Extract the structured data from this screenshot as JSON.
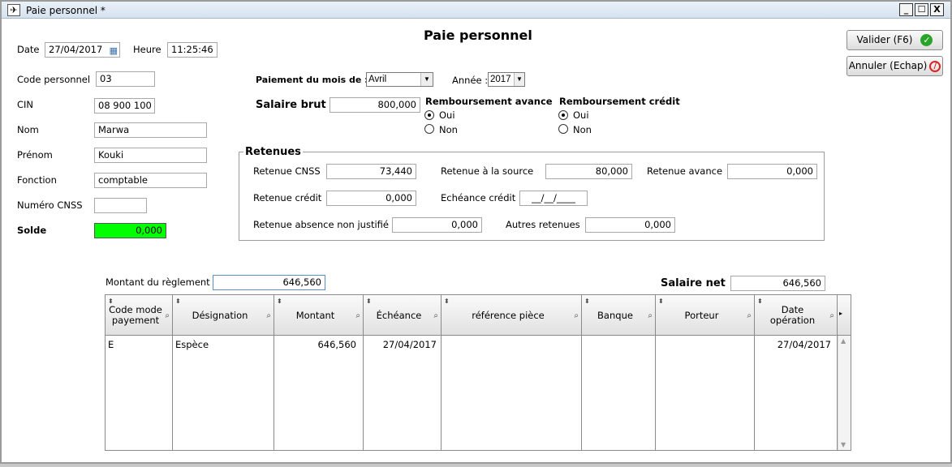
{
  "window": {
    "title": "Paie personnel *",
    "minimize": "_",
    "maximize": "☐",
    "close": "X"
  },
  "form_title": "Paie personnel",
  "header": {
    "date_label": "Date",
    "date_value": "27/04/2017",
    "heure_label": "Heure",
    "heure_value": "11:25:46"
  },
  "buttons": {
    "valider": "Valider (F6)",
    "annuler": "Annuler (Echap)"
  },
  "employee": {
    "code_label": "Code personnel",
    "code_value": "03",
    "cin_label": "CIN",
    "cin_value": "08 900 100",
    "nom_label": "Nom",
    "nom_value": "Marwa",
    "prenom_label": "Prénom",
    "prenom_value": "Kouki",
    "fonction_label": "Fonction",
    "fonction_value": "comptable",
    "cnss_label": "Numéro CNSS",
    "cnss_value": "",
    "solde_label": "Solde",
    "solde_value": "0,000"
  },
  "payment": {
    "mois_label": "Paiement du mois de :",
    "mois_value": "Avril",
    "annee_label": "Année :",
    "annee_value": "2017",
    "brut_label": "Salaire brut",
    "brut_value": "800,000",
    "avance_label": "Remboursement avance",
    "credit_label": "Remboursement crédit",
    "oui": "Oui",
    "non": "Non",
    "avance_selected": "Oui",
    "credit_selected": "Oui"
  },
  "retenues": {
    "title": "Retenues",
    "cnss_label": "Retenue CNSS",
    "cnss_value": "73,440",
    "source_label": "Retenue à la source",
    "source_value": "80,000",
    "avance_label": "Retenue avance",
    "avance_value": "0,000",
    "credit_label": "Retenue crédit",
    "credit_value": "0,000",
    "echeance_label": "Echéance crédit",
    "echeance_value": "__/__/____",
    "absence_label": "Retenue absence non justifié",
    "absence_value": "0,000",
    "autres_label": "Autres retenues",
    "autres_value": "0,000"
  },
  "reglement": {
    "montant_label": "Montant du règlement",
    "montant_value": "646,560",
    "net_label": "Salaire net",
    "net_value": "646,560"
  },
  "table": {
    "columns": [
      "Code mode payement",
      "Désignation",
      "Montant",
      "Échéance",
      "référence pièce",
      "Banque",
      "Porteur",
      "Date opération"
    ],
    "rows": [
      [
        "E",
        "Espèce",
        "646,560",
        "27/04/2017",
        "",
        "",
        "",
        "27/04/2017"
      ]
    ]
  },
  "colors": {
    "solde_bg": "#00ff00",
    "valider_icon": "#28a428",
    "annuler_icon": "#dd2222"
  }
}
